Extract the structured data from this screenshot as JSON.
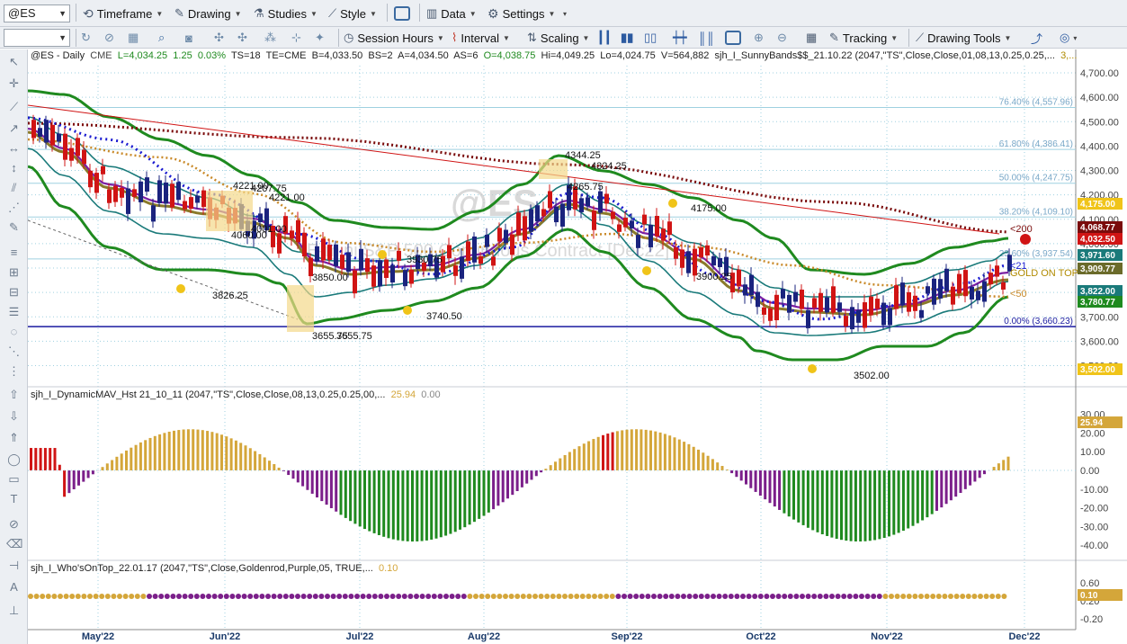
{
  "toolbar1": {
    "symbol": "@ES",
    "timeframe": "Timeframe",
    "drawing": "Drawing",
    "studies": "Studies",
    "style": "Style",
    "data": "Data",
    "settings": "Settings"
  },
  "toolbar2": {
    "session_hours": "Session Hours",
    "interval": "Interval",
    "scaling": "Scaling",
    "tracking": "Tracking",
    "drawing_tools": "Drawing Tools"
  },
  "price_pane": {
    "header": {
      "symbol": "@ES - Daily",
      "exchange": "CME",
      "last": "L=4,034.25",
      "change": "1.25",
      "change_pct": "0.03%",
      "ts": "TS=18",
      "te": "TE=CME",
      "bid": "B=4,033.50",
      "bs": "BS=2",
      "ask": "A=4,034.50",
      "as": "AS=6",
      "open": "O=4,038.75",
      "high": "Hi=4,049.25",
      "low": "Lo=4,024.75",
      "volume": "V=564,882",
      "study": "sjh_I_SunnyBands$$_21.10.22 (2047,\"TS\",Close,Close,01,08,13,0.25,0.25,...",
      "study_value": "3,..."
    },
    "watermark": "@ES",
    "watermark_sub": "E-mini S&P 500 Continuous Contract [Dec22]",
    "y_ticks": [
      "4,700.00",
      "4,600.00",
      "4,500.00",
      "4,400.00",
      "4,300.00",
      "4,200.00",
      "4,100.00",
      "4,000.00",
      "3,900.00",
      "3,800.00",
      "3,700.00",
      "3,600.00",
      "3,500.00"
    ],
    "fib_labels": [
      "76.40% (4,557.96)",
      "61.80% (4,386.41)",
      "50.00% (4,247.75)",
      "38.20% (4,109.10)",
      "23.60% (3,937.54)",
      "0.00% (3,660.23)"
    ],
    "annotations": [
      "4221.00",
      "4207.75",
      "4221.00",
      "4060.00",
      "4001.00",
      "3826.25",
      "3850.00",
      "3655.75",
      "3655.75",
      "3930.75",
      "3740.50",
      "4344.25",
      "4324.25",
      "4265.75",
      "4175.00",
      "3900.25",
      "3502.00"
    ],
    "ma_labels": [
      "<200",
      "GOLD ON TOP",
      "<21",
      "<50"
    ],
    "price_boxes": [
      {
        "label": "4,175.00",
        "color": "#f0c419"
      },
      {
        "label": "4,068.77",
        "color": "#7a0b0b"
      },
      {
        "label": "4,032.50",
        "color": "#d01414"
      },
      {
        "label": "3,971.60",
        "color": "#1a7a7a"
      },
      {
        "label": "3,909.77",
        "color": "#6b6b2a"
      },
      {
        "label": "3,822.00",
        "color": "#1a7a7a"
      },
      {
        "label": "3,780.77",
        "color": "#1f8a1f"
      },
      {
        "label": "3,502.00",
        "color": "#f0c419"
      }
    ]
  },
  "histogram_pane": {
    "header": "sjh_I_DynamicMAV_Hst 21_10_11 (2047,\"TS\",Close,Close,08,13,0.25,0.25,00,...",
    "value1": "25.94",
    "value2": "0.00",
    "y_ticks": [
      "30.00",
      "20.00",
      "10.00",
      "0.00",
      "-10.00",
      "-20.00",
      "-30.00",
      "-40.00"
    ],
    "current_label": "25.94"
  },
  "whos_pane": {
    "header": "sjh_I_Who'sOnTop_22.01.17 (2047,\"TS\",Close,Goldenrod,Purple,05, TRUE,...",
    "value": "0.10",
    "y_ticks": [
      "0.60",
      "0.20",
      "-0.20"
    ],
    "current_label": "0.10"
  },
  "x_axis": [
    "May'22",
    "Jun'22",
    "Jul'22",
    "Aug'22",
    "Sep'22",
    "Oct'22",
    "Nov'22",
    "Dec'22"
  ],
  "colors": {
    "up": "#1a237e",
    "down": "#d01414",
    "outer_band": "#1f8a1f",
    "inner_band": "#1a7a7a",
    "mav_purple": "#7b1fa2",
    "mav_olive": "#8a7a2a",
    "gold": "#d4a63a",
    "purple": "#7b1f8a"
  }
}
